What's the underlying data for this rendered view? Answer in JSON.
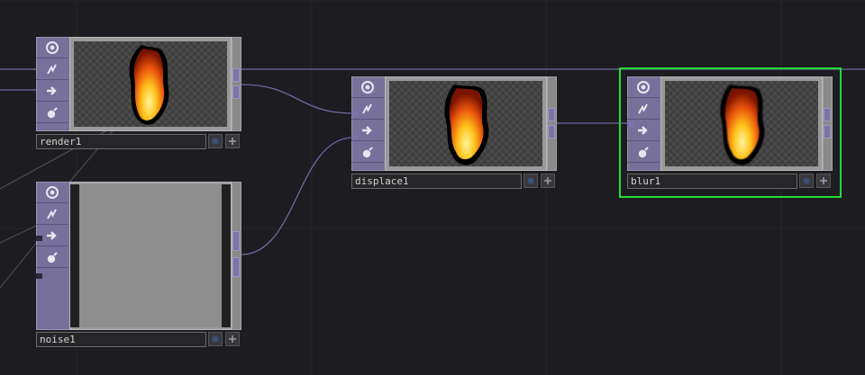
{
  "network": {
    "nodes": [
      {
        "name": "render1",
        "type": "render",
        "selected": false
      },
      {
        "name": "noise1",
        "type": "noise",
        "selected": false
      },
      {
        "name": "displace1",
        "type": "displace",
        "selected": false
      },
      {
        "name": "blur1",
        "type": "blur",
        "selected": true
      }
    ],
    "flag_icons": [
      "viewer-icon",
      "bypass-icon",
      "display-icon",
      "lock-icon"
    ],
    "button_icons": [
      "viewer-active-icon",
      "expand-icon"
    ],
    "colors": {
      "background": "#1c1c21",
      "flag_column": "#76709b",
      "wire": "#6e6aa0",
      "selection": "#22dd33",
      "name_bar": "#262629"
    }
  }
}
